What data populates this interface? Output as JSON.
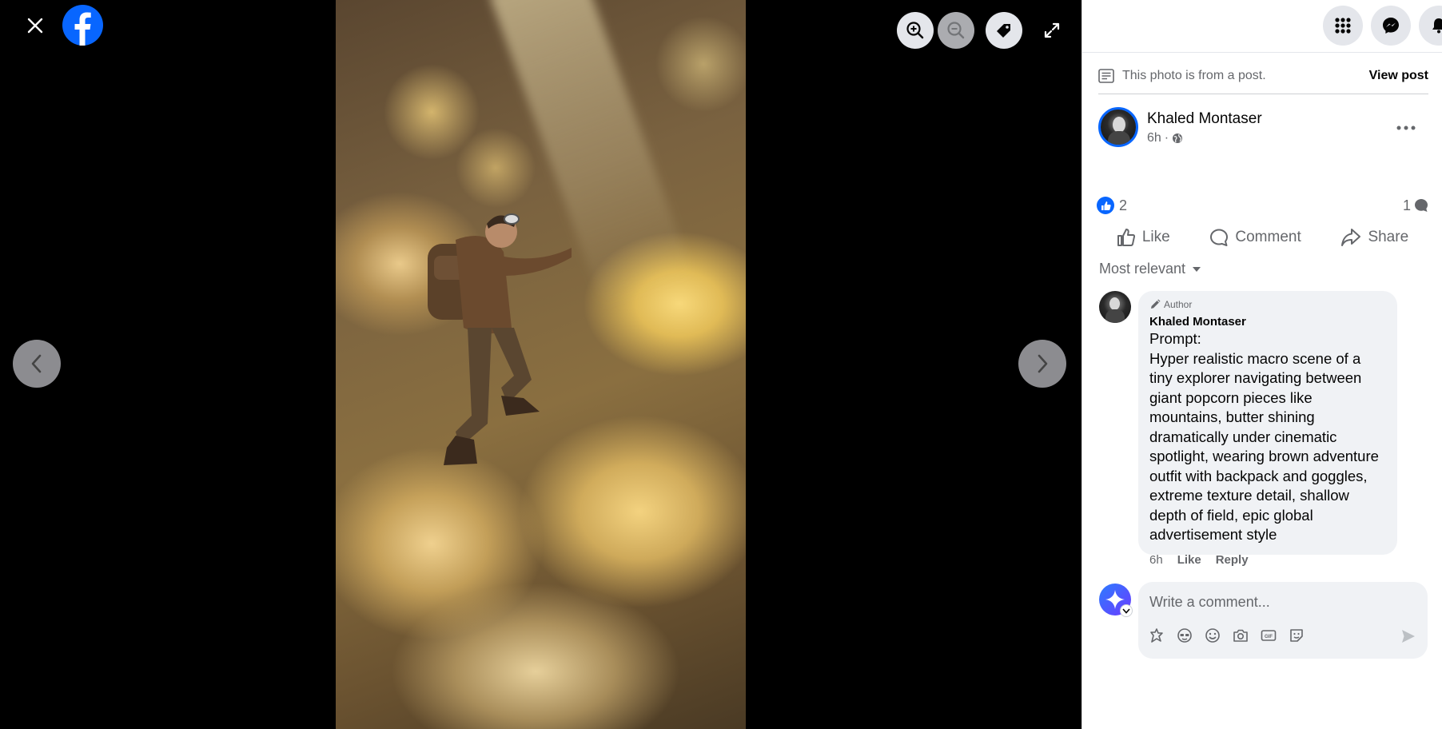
{
  "viewer": {
    "close_icon": "close-icon",
    "logo_icon": "facebook-logo-icon",
    "tools": [
      "zoom-in-icon",
      "zoom-out-icon",
      "tag-icon"
    ],
    "fullscreen_icon": "fullscreen-icon",
    "prev_icon": "chevron-left-icon",
    "next_icon": "chevron-right-icon"
  },
  "header": {
    "buttons": [
      "menu-grid-icon",
      "messenger-icon",
      "notifications-icon"
    ]
  },
  "post": {
    "from_post_text": "This photo is from a post.",
    "view_post_label": "View post",
    "author_name": "Khaled Montaser",
    "time": "6h",
    "separator": "·",
    "reaction_count": "2",
    "comment_count": "1",
    "actions": {
      "like": "Like",
      "comment": "Comment",
      "share": "Share"
    },
    "sort_label": "Most relevant"
  },
  "comment": {
    "badge": "Author",
    "author": "Khaled Montaser",
    "text": "Prompt:\nHyper realistic macro scene of a tiny explorer navigating between giant popcorn pieces like mountains, butter shining dramatically under cinematic spotlight, wearing brown adventure outfit with backpack and goggles, extreme texture detail, shallow depth of field, epic global advertisement style",
    "time": "6h",
    "like_label": "Like",
    "reply_label": "Reply"
  },
  "composer": {
    "placeholder": "Write a comment..."
  },
  "colors": {
    "brand": "#0866ff",
    "text_primary": "#050505",
    "text_secondary": "#65676b",
    "bubble_bg": "#f0f2f5"
  }
}
